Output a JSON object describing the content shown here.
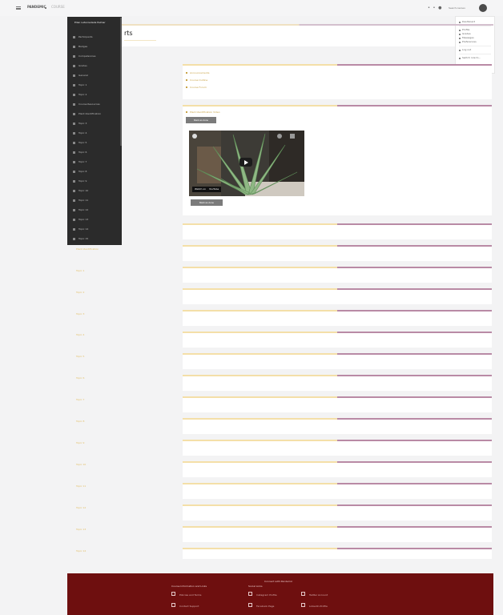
{
  "topbar": {
    "brand": "PANDEMIC",
    "crumb": "COURSE",
    "icons": "• • ●",
    "search_placeholder": "Search courses"
  },
  "user_menu": {
    "items": [
      "Dashboard",
      "Profile",
      "Grades",
      "Messages",
      "Preferences",
      "Log out"
    ],
    "switch_role": "Switch role to..."
  },
  "page": {
    "title": "rts"
  },
  "drawer": {
    "header": "Ellen LaSociedade Palmar",
    "items": [
      "Participants",
      "Badges",
      "Competencies",
      "Grades",
      "General",
      "Topic 1",
      "Topic 2",
      "Course Resources",
      "Plant Identification",
      "Topic 3",
      "Topic 4",
      "Topic 5",
      "Topic 6",
      "Topic 7",
      "Topic 8",
      "Topic 9",
      "Topic 10",
      "Topic 11",
      "Topic 12",
      "Topic 13",
      "Topic 14",
      "Topic 15",
      "Topic 16",
      "Topic 17",
      "Topic 18",
      "Topic 19"
    ]
  },
  "course_list": {
    "items": [
      "Plant Identification",
      "Topic 1",
      "Topic 2",
      "Topic 3",
      "Topic 4",
      "Topic 5",
      "Topic 6",
      "Topic 7",
      "Topic 8",
      "Topic 9",
      "Topic 10",
      "Topic 11",
      "Topic 12",
      "Topic 13",
      "Topic 14"
    ]
  },
  "section1": {
    "links": [
      "Announcements",
      "Course Outline",
      "Course Forum"
    ]
  },
  "section2": {
    "heading": "Plant Identification Video",
    "button_top": "Mark as done",
    "button_bottom": "Mark as done",
    "video": {
      "watch_label": "Watch on",
      "platform": "YouTube"
    }
  },
  "footer": {
    "heading": "Connect with Pandemic",
    "col1_title": "Course Information and Links",
    "col1_links": [
      "Policies and Terms",
      "Contact Support"
    ],
    "col2_title": "Social Links",
    "col2_links": [
      "Instagram Profile",
      "Facebook Page"
    ],
    "col3_links": [
      "Twitter Account",
      "LinkedIn Profile"
    ]
  },
  "colors": {
    "footer": "#6e0f0f",
    "drawer": "#2b2b2b",
    "accent_gold": "#c9a447",
    "accent_mauve": "#b98aa5"
  }
}
